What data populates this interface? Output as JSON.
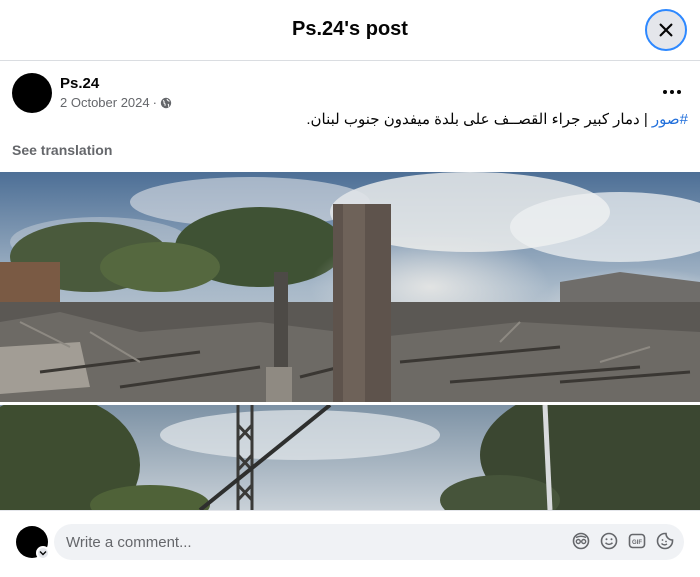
{
  "header": {
    "title": "Ps.24's post"
  },
  "post": {
    "author": "Ps.24",
    "date": "2 October 2024",
    "separator": "·",
    "hashtag": "#صور",
    "text": " | دمار كبير جراء القصــف على بلدة ميفدون جنوب لبنان.",
    "see_translation": "See translation"
  },
  "comment": {
    "placeholder": "Write a comment..."
  },
  "icons": {
    "close": "close-icon",
    "more": "more-icon",
    "privacy": "globe-icon",
    "avatar_badge": "chevron-down-icon",
    "composer": [
      "avatar-sticker-icon",
      "emoji-icon",
      "gif-icon",
      "sticker-icon"
    ]
  },
  "colors": {
    "link": "#216fdb",
    "secondary": "#65676b",
    "focus": "#2d88ff"
  }
}
